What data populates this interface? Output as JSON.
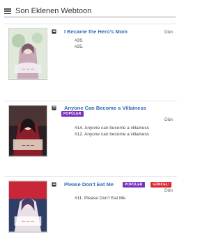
{
  "header": {
    "title": "Son Eklenen Webtoon",
    "menu_icon": "hamburger-menu-icon"
  },
  "entries": [
    {
      "title": "I Became the Hero's Mom",
      "day": "Dün",
      "badges": [],
      "chapters": [
        "#26.",
        "#25."
      ],
      "cover_colors": [
        "#d7e6d0",
        "#c9a9b8",
        "#8a6f7a"
      ]
    },
    {
      "title": "Anyone Can Become a Villainess",
      "day": "Dün",
      "badges": [
        "POPÜLER"
      ],
      "chapters": [
        "#14. Anyone can become a villainess",
        "#12. Anyone can become a villainess"
      ],
      "cover_colors": [
        "#3b2a2a",
        "#8b1e2a",
        "#d7c9b5"
      ]
    },
    {
      "title": "Please Don't Eat Me",
      "day": "Dün",
      "badges": [
        "POPÜLER",
        "GÜNCEL!"
      ],
      "chapters": [
        "#11. Please Don't Eat Me"
      ],
      "cover_colors": [
        "#2d3f66",
        "#c9263a",
        "#e8e0e6"
      ]
    }
  ],
  "colors": {
    "title_link": "#2f6db1",
    "popular_badge": "#7b2fbe",
    "updated_badge": "#d9232d"
  }
}
